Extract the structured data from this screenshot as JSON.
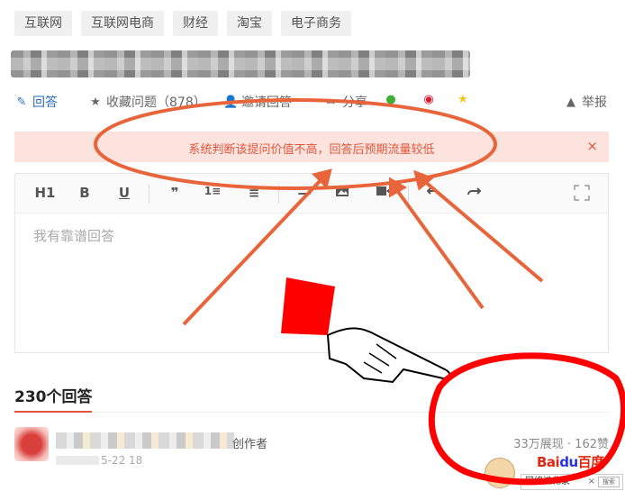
{
  "topic_tags": [
    "互联网",
    "互联网电商",
    "财经",
    "淘宝",
    "电子商务"
  ],
  "actions": {
    "answer": "回答",
    "follow": "收藏问题（878）",
    "invite": "邀请回答",
    "share": "分享",
    "report": "举报"
  },
  "warning": {
    "text": "系统判断该提问价值不高，回答后预期流量较低",
    "close": "×"
  },
  "editor": {
    "toolbar": [
      "H1",
      "B",
      "U",
      "❞",
      "1≡",
      "≡",
      "—",
      "image",
      "video",
      "undo",
      "redo",
      "fullscreen"
    ],
    "placeholder": "我有靠谱回答"
  },
  "answers": {
    "count_label": "230个回答",
    "first": {
      "author_role": "创作者",
      "date": "5-22 18",
      "stats": "33万展现 · 162赞"
    }
  },
  "watermark": {
    "logo_left": "Bai",
    "logo_paw": "du",
    "logo_right": "百度",
    "caption": "网络进化录",
    "close": "×",
    "search": "搜索"
  },
  "colors": {
    "accent": "#e0553c",
    "warning_bg": "#fde3dd",
    "annotation": "#e8643a",
    "annotation_red": "#ff0000",
    "link": "#2e6bb8"
  }
}
